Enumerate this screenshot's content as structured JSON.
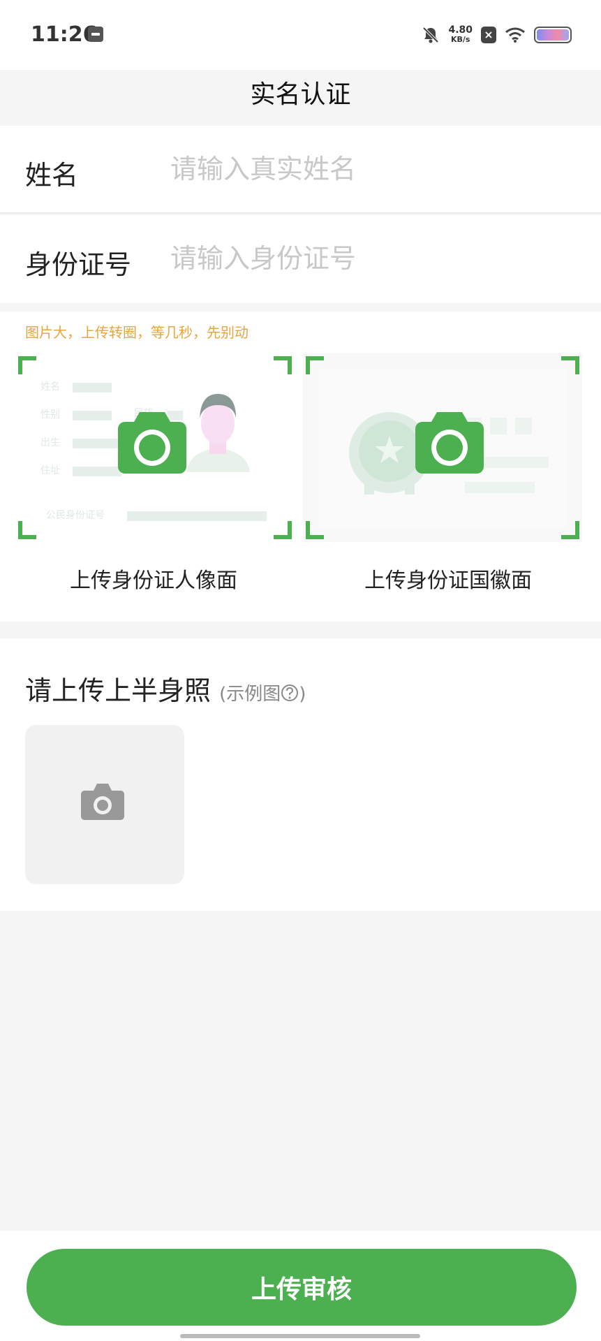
{
  "status_bar": {
    "time": "11:26",
    "net_speed_value": "4.80",
    "net_speed_unit": "KB/s",
    "icons": [
      "notification-box-icon",
      "mute-bell-icon",
      "close-box-icon",
      "wifi-icon",
      "battery-icon"
    ]
  },
  "header": {
    "title": "实名认证"
  },
  "form": {
    "name_label": "姓名",
    "name_placeholder": "请输入真实姓名",
    "id_label": "身份证号",
    "id_placeholder": "请输入身份证号"
  },
  "id_upload": {
    "hint": "图片大，上传转圈，等几秒，先别动",
    "front_caption": "上传身份证人像面",
    "back_caption": "上传身份证国徽面",
    "front_card_fields": [
      "姓名",
      "性别",
      "民族",
      "出生",
      "住址",
      "公民身份证号"
    ]
  },
  "photo_upload": {
    "title": "请上传上半身照",
    "example_label": "(示例图",
    "example_suffix": ")"
  },
  "footer": {
    "submit_label": "上传审核"
  },
  "colors": {
    "accent": "#4caf50",
    "hint": "#e8a53a",
    "background": "#f5f5f5"
  }
}
